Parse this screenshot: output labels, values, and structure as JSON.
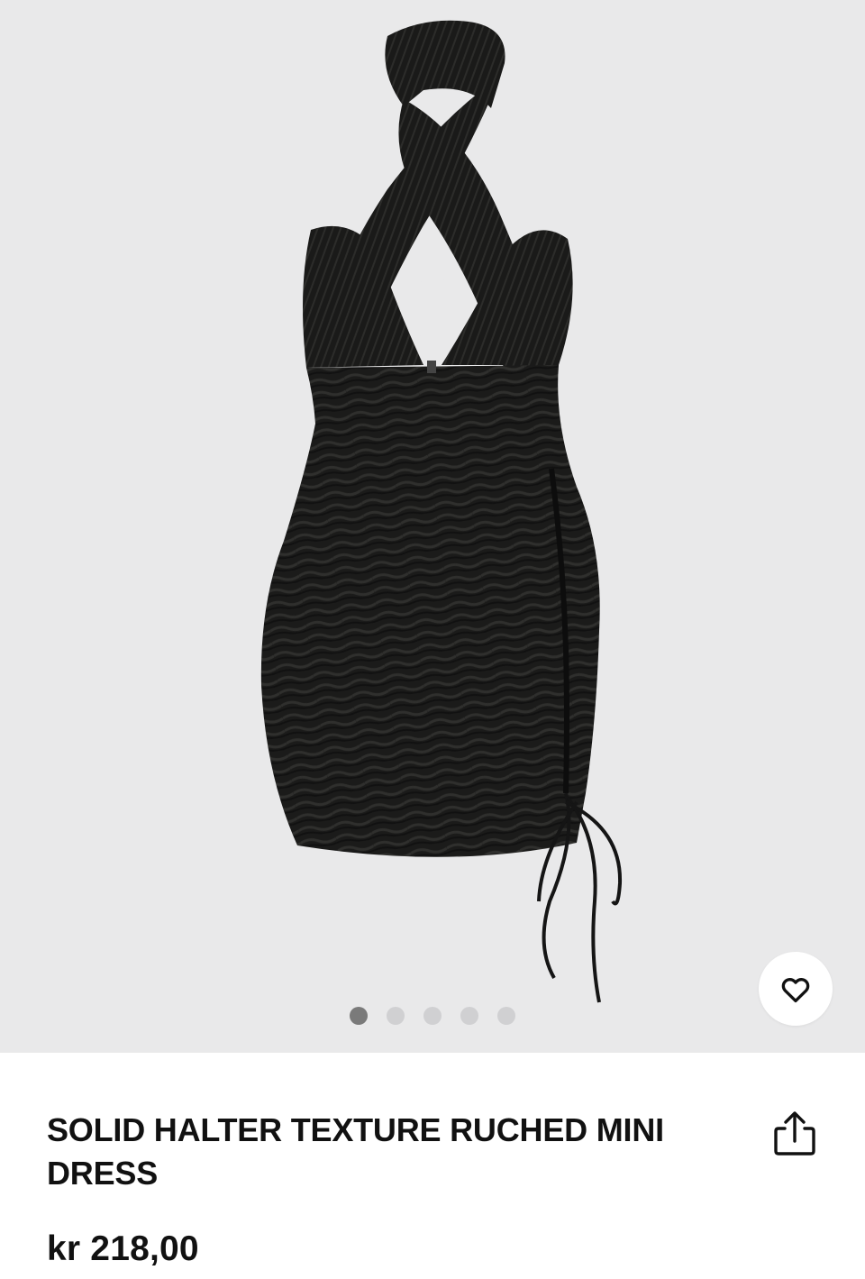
{
  "product": {
    "title": "SOLID HALTER TEXTURE RUCHED MINI DRESS",
    "price": "kr 218,00",
    "image_alt": "Black halter ruched mini dress"
  },
  "gallery": {
    "total_images": 5,
    "active_index": 0
  },
  "icons": {
    "wishlist": "heart-icon",
    "share": "share-icon"
  },
  "colors": {
    "gallery_bg": "#e9e9ea",
    "dot_active": "#7a7a7a",
    "dot_inactive": "#d0d0d2",
    "text": "#111111"
  }
}
